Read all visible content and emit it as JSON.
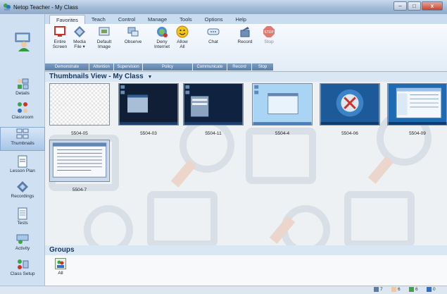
{
  "window": {
    "title": "Netop Teacher - My Class",
    "minimize": "–",
    "maximize": "□",
    "close": "x"
  },
  "tabs": [
    {
      "label": "Favorites",
      "active": true
    },
    {
      "label": "Teach"
    },
    {
      "label": "Control"
    },
    {
      "label": "Manage"
    },
    {
      "label": "Tools"
    },
    {
      "label": "Options"
    },
    {
      "label": "Help"
    }
  ],
  "ribbon": {
    "buttons": [
      {
        "line1": "Entire",
        "line2": "Screen",
        "icon": "monitor-icon"
      },
      {
        "line1": "Media",
        "line2": "File ▾",
        "icon": "media-file-icon"
      },
      {
        "line1": "Default",
        "line2": "Image",
        "icon": "image-icon"
      },
      {
        "line1": "Observe",
        "line2": "",
        "icon": "observe-icon"
      },
      {
        "line1": "Deny",
        "line2": "Internet",
        "icon": "deny-internet-icon"
      },
      {
        "line1": "Allow",
        "line2": "All",
        "icon": "allow-all-icon"
      },
      {
        "line1": "Chat",
        "line2": "",
        "icon": "chat-icon"
      },
      {
        "line1": "Record",
        "line2": "",
        "icon": "record-icon"
      },
      {
        "line1": "Stop",
        "line2": "",
        "icon": "stop-icon"
      }
    ],
    "groups": [
      "Demonstrate",
      "Attention",
      "Supervision",
      "Policy",
      "Communicate",
      "Record",
      "Stop"
    ]
  },
  "nav": [
    {
      "label": "Details",
      "icon": "details-icon"
    },
    {
      "label": "Classroom",
      "icon": "classroom-icon"
    },
    {
      "label": "Thumbnails",
      "icon": "thumbnails-icon",
      "active": true
    },
    {
      "label": "Lesson Plan",
      "icon": "lesson-plan-icon"
    },
    {
      "label": "Recordings",
      "icon": "recordings-icon"
    },
    {
      "label": "Tests",
      "icon": "tests-icon"
    },
    {
      "label": "Activity",
      "icon": "activity-icon"
    },
    {
      "label": "Class Setup",
      "icon": "class-setup-icon"
    }
  ],
  "main": {
    "title": "Thumbnails View - My Class",
    "dropdown_arrow": "▼"
  },
  "thumbnails": [
    {
      "name": "5504-05",
      "style": "blank"
    },
    {
      "name": "5504-03",
      "style": "dark"
    },
    {
      "name": "5504-11",
      "style": "dark-window"
    },
    {
      "name": "5504-4",
      "style": "light-blue"
    },
    {
      "name": "5504-06",
      "style": "wallpaper"
    },
    {
      "name": "5504-09",
      "style": "explorer"
    },
    {
      "name": "5504-7",
      "style": "document"
    }
  ],
  "groups": {
    "title": "Groups",
    "items": [
      {
        "label": "All",
        "icon": "group-all-icon"
      }
    ]
  },
  "status": [
    {
      "value": "7",
      "icon": "computers-icon"
    },
    {
      "value": "6",
      "icon": "students-icon"
    },
    {
      "value": "6",
      "icon": "connected-icon"
    },
    {
      "value": "0",
      "icon": "selected-icon"
    }
  ]
}
